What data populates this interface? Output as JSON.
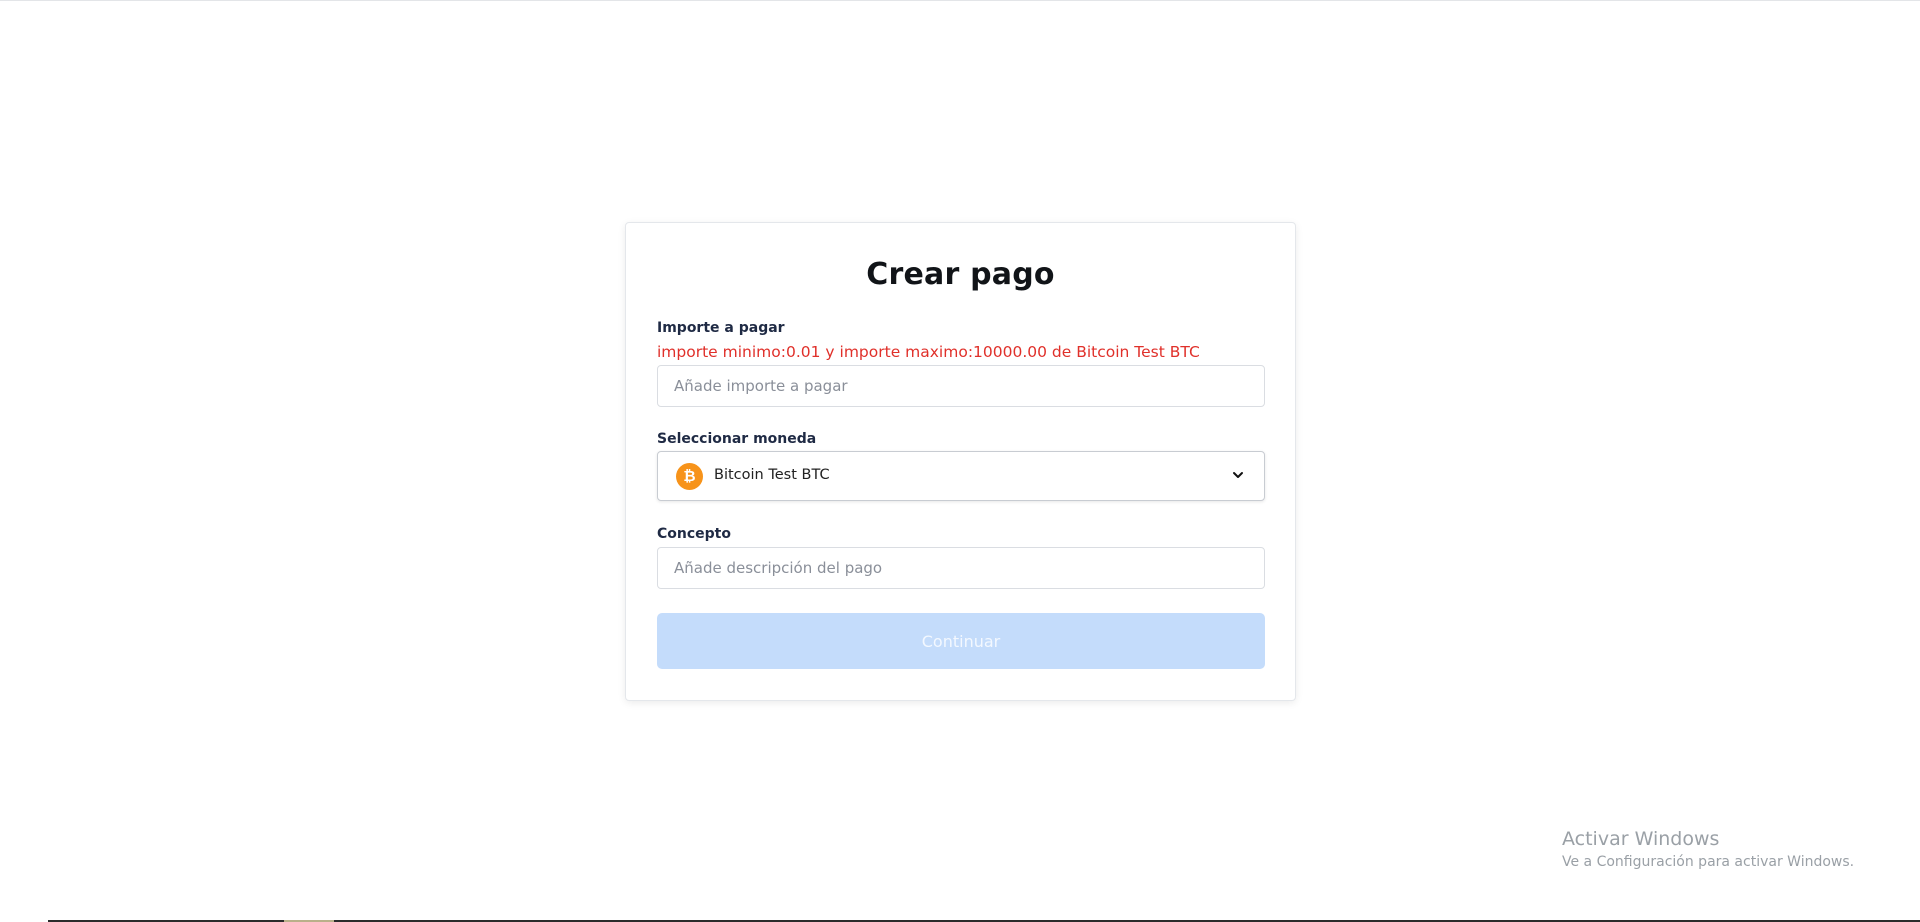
{
  "page": {
    "title": "Crear pago"
  },
  "amount_field": {
    "label": "Importe a pagar",
    "error": "importe minimo:0.01 y importe maximo:10000.00 de Bitcoin Test BTC",
    "value": "",
    "placeholder": "Añade importe a pagar"
  },
  "currency_field": {
    "label": "Seleccionar moneda",
    "selected": "Bitcoin Test BTC",
    "icon": "bitcoin-icon",
    "icon_glyph": "₿",
    "icon_color": "#f7931a"
  },
  "concept_field": {
    "label": "Concepto",
    "value": "",
    "placeholder": "Añade descripción del pago"
  },
  "actions": {
    "continue_label": "Continuar"
  },
  "watermark": {
    "title": "Activar Windows",
    "subtitle": "Ve a Configuración para activar Windows."
  },
  "colors": {
    "error": "#e0302a",
    "button_disabled_bg": "#c4dcfb",
    "label": "#1f2a44"
  }
}
